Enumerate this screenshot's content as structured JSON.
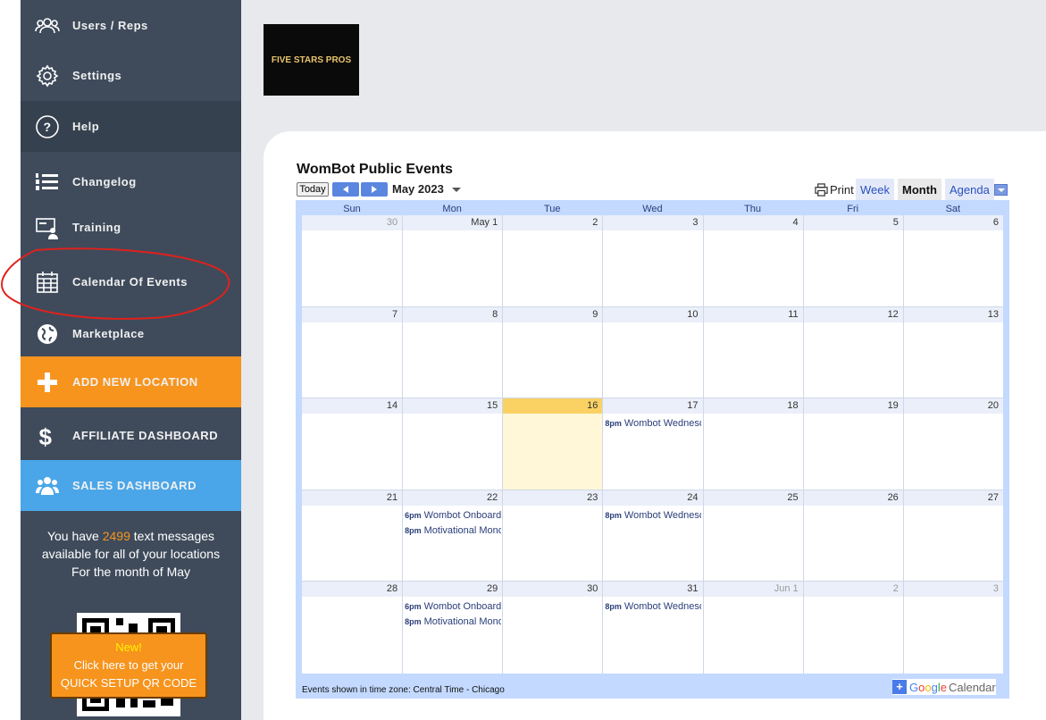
{
  "sidebar": {
    "items": [
      {
        "label": "Users / Reps",
        "icon": "users-icon"
      },
      {
        "label": "Settings",
        "icon": "gear-icon"
      },
      {
        "label": "Help",
        "icon": "help-icon"
      },
      {
        "label": "Changelog",
        "icon": "list-icon"
      },
      {
        "label": "Training",
        "icon": "training-icon"
      },
      {
        "label": "Calendar Of Events",
        "icon": "calendar-icon"
      },
      {
        "label": "Marketplace",
        "icon": "globe-icon"
      },
      {
        "label": "ADD NEW LOCATION",
        "icon": "plus-icon"
      },
      {
        "label": "AFFILIATE DASHBOARD",
        "icon": "dollar-icon"
      },
      {
        "label": "SALES DASHBOARD",
        "icon": "group-icon"
      }
    ],
    "sms": {
      "prefix": "You have",
      "count": "2499",
      "suffix": "text messages",
      "line2": "available for all of your locations",
      "line3": "For the month of May"
    },
    "qr": {
      "new_label": "New!",
      "line1": "Click here to get your",
      "line2": "QUICK SETUP QR CODE"
    }
  },
  "logo": {
    "text": "FIVE STARS PROS"
  },
  "calendar": {
    "title": "WomBot Public Events",
    "today_label": "Today",
    "month_label": "May 2023",
    "print_label": "Print",
    "tabs": [
      "Week",
      "Month",
      "Agenda"
    ],
    "active_tab": "Month",
    "weekdays": [
      "Sun",
      "Mon",
      "Tue",
      "Wed",
      "Thu",
      "Fri",
      "Sat"
    ],
    "weeks": [
      [
        {
          "d": "30",
          "o": true
        },
        {
          "d": "May 1"
        },
        {
          "d": "2"
        },
        {
          "d": "3"
        },
        {
          "d": "4"
        },
        {
          "d": "5"
        },
        {
          "d": "6"
        }
      ],
      [
        {
          "d": "7"
        },
        {
          "d": "8"
        },
        {
          "d": "9"
        },
        {
          "d": "10"
        },
        {
          "d": "11"
        },
        {
          "d": "12"
        },
        {
          "d": "13"
        }
      ],
      [
        {
          "d": "14"
        },
        {
          "d": "15"
        },
        {
          "d": "16",
          "today": true
        },
        {
          "d": "17"
        },
        {
          "d": "18"
        },
        {
          "d": "19"
        },
        {
          "d": "20"
        }
      ],
      [
        {
          "d": "21"
        },
        {
          "d": "22"
        },
        {
          "d": "23"
        },
        {
          "d": "24"
        },
        {
          "d": "25"
        },
        {
          "d": "26"
        },
        {
          "d": "27"
        }
      ],
      [
        {
          "d": "28"
        },
        {
          "d": "29"
        },
        {
          "d": "30"
        },
        {
          "d": "31"
        },
        {
          "d": "Jun 1",
          "o": true
        },
        {
          "d": "2",
          "o": true
        },
        {
          "d": "3",
          "o": true
        }
      ]
    ],
    "events": [
      {
        "week": 2,
        "day": 3,
        "slot": 0,
        "time": "8pm",
        "title": "Wombot Wednesday"
      },
      {
        "week": 3,
        "day": 1,
        "slot": 0,
        "time": "6pm",
        "title": "Wombot Onboarding"
      },
      {
        "week": 3,
        "day": 1,
        "slot": 1,
        "time": "8pm",
        "title": "Motivational Monday"
      },
      {
        "week": 3,
        "day": 3,
        "slot": 0,
        "time": "8pm",
        "title": "Wombot Wednesday"
      },
      {
        "week": 4,
        "day": 1,
        "slot": 0,
        "time": "6pm",
        "title": "Wombot Onboarding"
      },
      {
        "week": 4,
        "day": 1,
        "slot": 1,
        "time": "8pm",
        "title": "Motivational Monday"
      },
      {
        "week": 4,
        "day": 3,
        "slot": 0,
        "time": "8pm",
        "title": "Wombot Wednesday"
      }
    ],
    "timezone_note": "Events shown in time zone: Central Time - Chicago",
    "gcal": {
      "g": "G",
      "o1": "o",
      "o2": "o",
      "g2": "g",
      "l": "l",
      "e": "e",
      "word": "Calendar"
    }
  },
  "colors": {
    "sidebar": "#3f4b5b",
    "accent_orange": "#f7941d",
    "accent_blue": "#4aa6e8",
    "annotation_red": "#e0211c"
  }
}
